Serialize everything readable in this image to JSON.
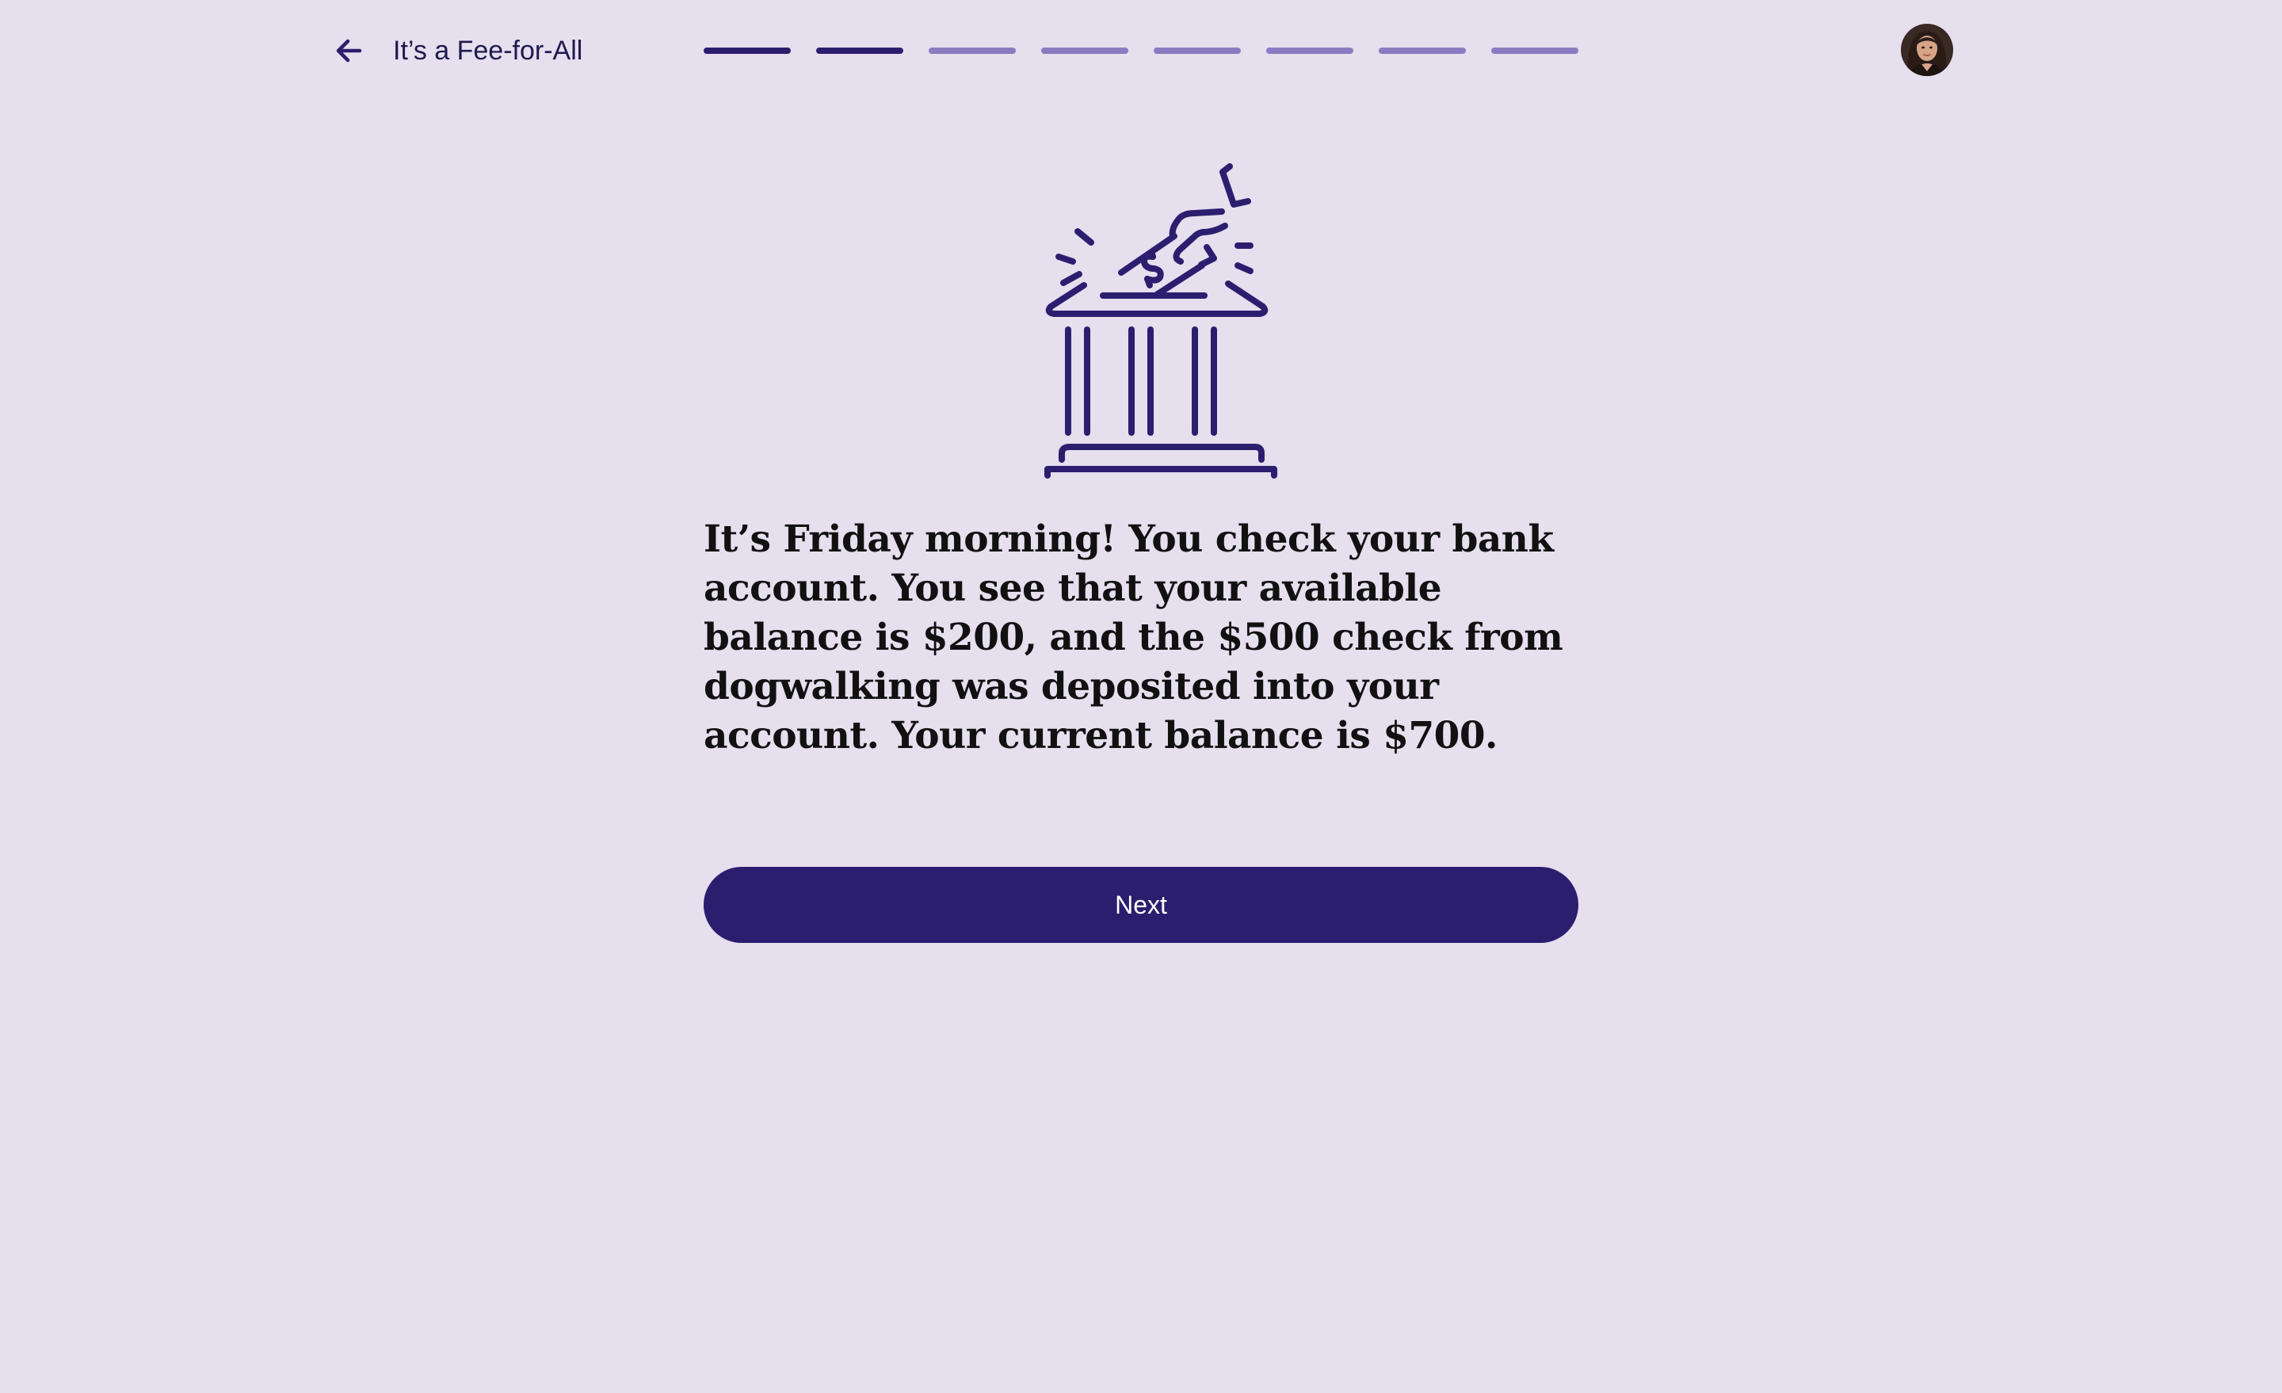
{
  "header": {
    "back_icon": "arrow-left-icon",
    "title": "It’s a Fee-for-All",
    "progress": {
      "total_steps": 8,
      "completed_steps": 2
    },
    "avatar_icon": "user-avatar"
  },
  "illustration": {
    "icon": "bank-deposit-icon"
  },
  "scenario": {
    "text": "It’s Friday morning! You check your bank account. You see that your available balance is $200, and the $500 check from dogwalking was deposited into your account. Your current balance is $700."
  },
  "actions": {
    "next_label": "Next"
  },
  "colors": {
    "background": "#e5dfee",
    "primary": "#2c1e6e",
    "progress_inactive": "#8a7cc1",
    "title_text": "#1f1a4e",
    "body_text": "#111111"
  }
}
